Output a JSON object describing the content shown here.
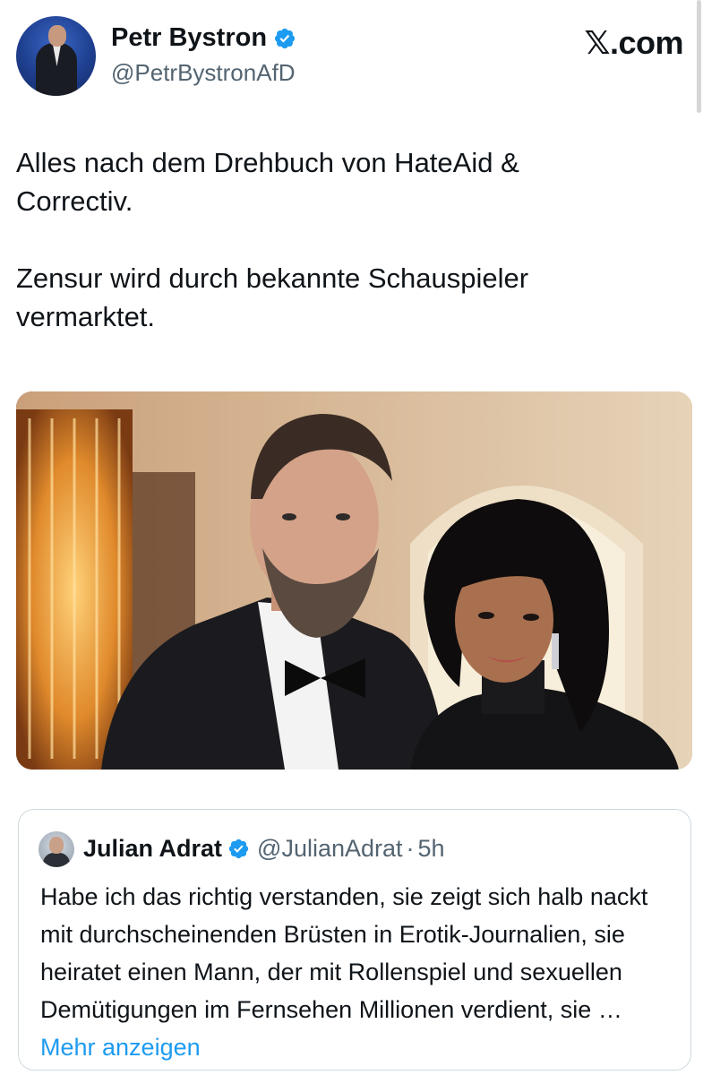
{
  "author": {
    "name": "Petr Bystron",
    "handle": "@PetrBystronAfD",
    "verified_icon": "verified-badge-icon"
  },
  "site_logo": "𝕏.com",
  "tweet": {
    "text": "Alles nach dem Drehbuch von HateAid &\nCorrectiv.\n\nZensur wird durch bekannte Schauspieler\nvermarktet."
  },
  "quoted_tweet": {
    "name": "Julian Adrat",
    "handle": "@JulianAdrat",
    "separator": "·",
    "time": "5h",
    "text": "Habe ich das richtig verstanden, sie zeigt sich halb nackt mit durchscheinenden Brüsten in Erotik-Journalien, sie heiratet einen Mann, der mit Rollenspiel und sexuellen Demütigungen im Fernsehen Millionen verdient, sie …",
    "more_link": "Mehr anzeigen"
  },
  "colors": {
    "verified_blue": "#1d9bf0",
    "link_blue": "#1d9bf0",
    "secondary_text": "#536471",
    "primary_text": "#0f1419",
    "border": "#cfd9de"
  }
}
